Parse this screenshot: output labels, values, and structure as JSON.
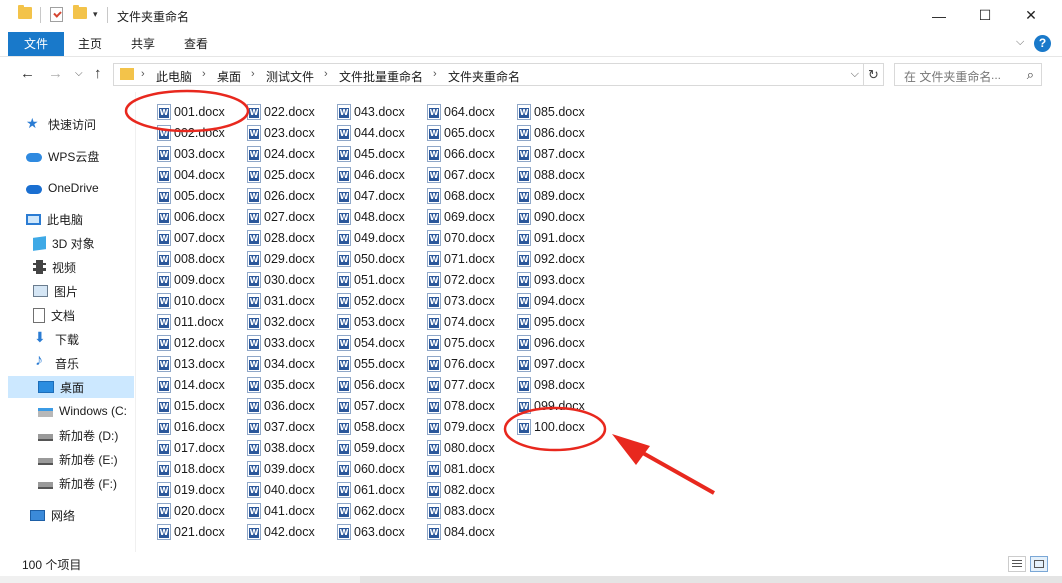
{
  "window": {
    "title": "文件夹重命名",
    "minimize": "—",
    "maximize": "☐",
    "close": "✕"
  },
  "ribbon": {
    "tabs": [
      "文件",
      "主页",
      "共享",
      "查看"
    ],
    "collapse_icon": "chevron-down-icon",
    "help_icon": "help-icon"
  },
  "address": {
    "breadcrumbs": [
      "此电脑",
      "桌面",
      "测试文件",
      "文件批量重命名",
      "文件夹重命名"
    ],
    "search_placeholder": "在 文件夹重命名"
  },
  "sidebar": {
    "items": [
      {
        "label": "快速访问",
        "icon": "star-icon"
      },
      {
        "label": "WPS云盘",
        "icon": "cloud-icon"
      },
      {
        "label": "OneDrive",
        "icon": "onedrive-icon"
      },
      {
        "label": "此电脑",
        "icon": "computer-icon"
      },
      {
        "label": "3D 对象",
        "icon": "cube-icon"
      },
      {
        "label": "视频",
        "icon": "video-icon"
      },
      {
        "label": "图片",
        "icon": "picture-icon"
      },
      {
        "label": "文档",
        "icon": "document-icon"
      },
      {
        "label": "下载",
        "icon": "download-icon"
      },
      {
        "label": "音乐",
        "icon": "music-icon"
      },
      {
        "label": "桌面",
        "icon": "desktop-icon",
        "selected": true
      },
      {
        "label": "Windows (C:",
        "icon": "windows-drive-icon"
      },
      {
        "label": "新加卷 (D:)",
        "icon": "drive-icon"
      },
      {
        "label": "新加卷 (E:)",
        "icon": "drive-icon"
      },
      {
        "label": "新加卷 (F:)",
        "icon": "drive-icon"
      },
      {
        "label": "网络",
        "icon": "network-icon"
      }
    ]
  },
  "files": [
    "001.docx",
    "002.docx",
    "003.docx",
    "004.docx",
    "005.docx",
    "006.docx",
    "007.docx",
    "008.docx",
    "009.docx",
    "010.docx",
    "011.docx",
    "012.docx",
    "013.docx",
    "014.docx",
    "015.docx",
    "016.docx",
    "017.docx",
    "018.docx",
    "019.docx",
    "020.docx",
    "021.docx",
    "022.docx",
    "023.docx",
    "024.docx",
    "025.docx",
    "026.docx",
    "027.docx",
    "028.docx",
    "029.docx",
    "030.docx",
    "031.docx",
    "032.docx",
    "033.docx",
    "034.docx",
    "035.docx",
    "036.docx",
    "037.docx",
    "038.docx",
    "039.docx",
    "040.docx",
    "041.docx",
    "042.docx",
    "043.docx",
    "044.docx",
    "045.docx",
    "046.docx",
    "047.docx",
    "048.docx",
    "049.docx",
    "050.docx",
    "051.docx",
    "052.docx",
    "053.docx",
    "054.docx",
    "055.docx",
    "056.docx",
    "057.docx",
    "058.docx",
    "059.docx",
    "060.docx",
    "061.docx",
    "062.docx",
    "063.docx",
    "064.docx",
    "065.docx",
    "066.docx",
    "067.docx",
    "068.docx",
    "069.docx",
    "070.docx",
    "071.docx",
    "072.docx",
    "073.docx",
    "074.docx",
    "075.docx",
    "076.docx",
    "077.docx",
    "078.docx",
    "079.docx",
    "080.docx",
    "081.docx",
    "082.docx",
    "083.docx",
    "084.docx",
    "085.docx",
    "086.docx",
    "087.docx",
    "088.docx",
    "089.docx",
    "090.docx",
    "091.docx",
    "092.docx",
    "093.docx",
    "094.docx",
    "095.docx",
    "096.docx",
    "097.docx",
    "098.docx",
    "099.docx",
    "100.docx"
  ],
  "status": {
    "item_count": "100 个项目"
  },
  "colors": {
    "accent": "#1979ca",
    "annotation": "#e8281e",
    "selection": "#cce8ff"
  }
}
